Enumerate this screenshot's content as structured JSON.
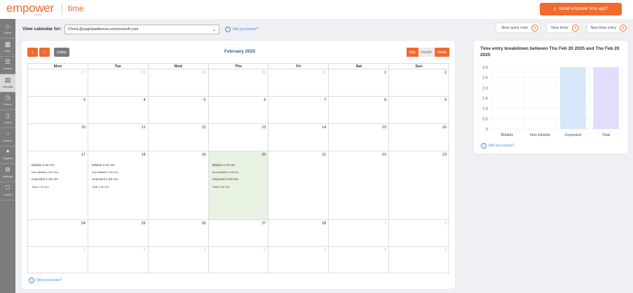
{
  "header": {
    "logo_text": "empower",
    "logo_sub": "solutions",
    "app_name": "time",
    "install_label": "Install empower time app?"
  },
  "sidebar": {
    "items": [
      {
        "label": "home",
        "icon": "home-icon",
        "glyph": "⌂"
      },
      {
        "label": "time",
        "icon": "grid-icon",
        "glyph": "▦"
      },
      {
        "label": "entries",
        "icon": "list-icon",
        "glyph": "☰"
      },
      {
        "label": "calendar",
        "icon": "calendar-icon",
        "glyph": "▤"
      },
      {
        "label": "timers",
        "icon": "stopwatch-icon",
        "glyph": "◷"
      },
      {
        "label": "notes",
        "icon": "note-icon",
        "glyph": "▯"
      },
      {
        "label": "tracker",
        "icon": "tracker-icon",
        "glyph": "⁘"
      },
      {
        "label": "suggest",
        "icon": "sparkle-icon",
        "glyph": "✦"
      },
      {
        "label": "settings",
        "icon": "gear-icon",
        "glyph": "⚙"
      },
      {
        "label": "admin",
        "icon": "admin-icon",
        "glyph": "⛉"
      }
    ],
    "active": "calendar"
  },
  "view": {
    "label": "View calendar for:",
    "selected_user": "ChrisL@saglobaldemos.onmicrosoft.com",
    "did_you_know": "Did you know?"
  },
  "quick_buttons": {
    "note": "New quick note",
    "timer": "New timer",
    "entry": "New time entry"
  },
  "calendar": {
    "title": "February 2025",
    "today_label": "today",
    "views": {
      "day": "day",
      "month": "month",
      "week": "week"
    },
    "weekdays": [
      "Mon",
      "Tue",
      "Wed",
      "Thu",
      "Fri",
      "Sat",
      "Sun"
    ],
    "weeks": [
      [
        {
          "n": "27",
          "o": true
        },
        {
          "n": "28",
          "o": true
        },
        {
          "n": "29",
          "o": true
        },
        {
          "n": "30",
          "o": true
        },
        {
          "n": "31",
          "o": true
        },
        {
          "n": "1"
        },
        {
          "n": "2"
        }
      ],
      [
        {
          "n": "3"
        },
        {
          "n": "4"
        },
        {
          "n": "5"
        },
        {
          "n": "6"
        },
        {
          "n": "7"
        },
        {
          "n": "8"
        },
        {
          "n": "9"
        }
      ],
      [
        {
          "n": "10"
        },
        {
          "n": "11"
        },
        {
          "n": "12"
        },
        {
          "n": "13"
        },
        {
          "n": "14"
        },
        {
          "n": "15"
        },
        {
          "n": "16"
        }
      ],
      [
        {
          "n": "17",
          "e": [
            "Billable 0.00 Hrs",
            "Non-Billable 0.00 Hrs",
            "Unposted 1.20 Hrs",
            "Total 1.20 Hrs"
          ]
        },
        {
          "n": "18",
          "e": [
            "Billable 0.00 Hrs",
            "Non-Billable 0.00 Hrs",
            "Unposted 1.50 Hrs",
            "Total 1.50 Hrs"
          ]
        },
        {
          "n": "19"
        },
        {
          "n": "20",
          "hl": true,
          "e": [
            "Billable 0.00 Hrs",
            "Non-Billable 0.00 Hrs",
            "Unposted 3.00 Hrs",
            "Total 3.00 Hrs"
          ]
        },
        {
          "n": "21"
        },
        {
          "n": "22"
        },
        {
          "n": "23"
        }
      ],
      [
        {
          "n": "24"
        },
        {
          "n": "25"
        },
        {
          "n": "26"
        },
        {
          "n": "27"
        },
        {
          "n": "28"
        },
        {
          "n": "1",
          "o": true
        },
        {
          "n": "2",
          "o": true
        }
      ],
      [
        {
          "n": "3",
          "o": true
        },
        {
          "n": "4",
          "o": true
        },
        {
          "n": "5",
          "o": true
        },
        {
          "n": "6",
          "o": true
        },
        {
          "n": "7",
          "o": true
        },
        {
          "n": "8",
          "o": true
        },
        {
          "n": "9",
          "o": true
        }
      ]
    ],
    "did_you_know": "Did you know?"
  },
  "breakdown": {
    "title": "Time entry breakdown between Thu Feb 20 2025 and Thu Feb 20 2025",
    "did_you_know": "Did you know?"
  },
  "chart_data": {
    "type": "bar",
    "categories": [
      "Billable",
      "Non-billable",
      "Unposted",
      "Total"
    ],
    "values": [
      0,
      0,
      3.0,
      3.0
    ],
    "colors": [
      "#cfe3f7",
      "#cfe3f7",
      "#d6e8f9",
      "#e4dcfb"
    ],
    "yticks": [
      "3.0",
      "2.5",
      "2.0",
      "1.5",
      "1.0",
      "0.5",
      "0"
    ],
    "ylim": [
      0,
      3.0
    ],
    "grid": true
  }
}
